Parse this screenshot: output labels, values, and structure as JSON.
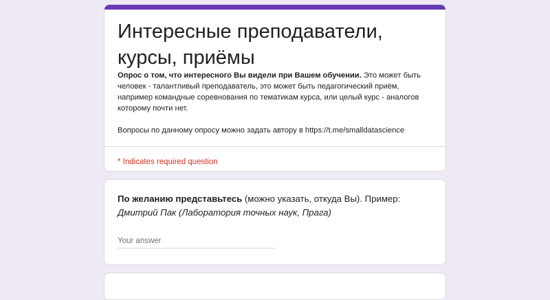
{
  "theme": {
    "accent": "#673ab7",
    "background": "#eee9f5",
    "required": "#d93025"
  },
  "header": {
    "title": "Интересные преподаватели, курсы, приёмы",
    "description_bold": "Опрос о том, что интересного Вы видели при Вашем обучении.",
    "description_rest": " Это может быть человек - талантливый преподаватель, это может быть педагогический приём, например командные соревнования по тематикам курса, или целый курс - аналогов которому почти нет.",
    "description_contact": "Вопросы по данному опросу можно задать автору в https://t.me/smalldatascience",
    "required_note": "* Indicates required question"
  },
  "question1": {
    "title_bold": "По желанию представьтесь",
    "title_normal": " (можно указать, откуда Вы). Пример: ",
    "title_italic": "Дмитрий Пак (Лаборатория точных наук, Прага)",
    "placeholder": "Your answer",
    "value": ""
  },
  "question2": {
    "title": ""
  }
}
